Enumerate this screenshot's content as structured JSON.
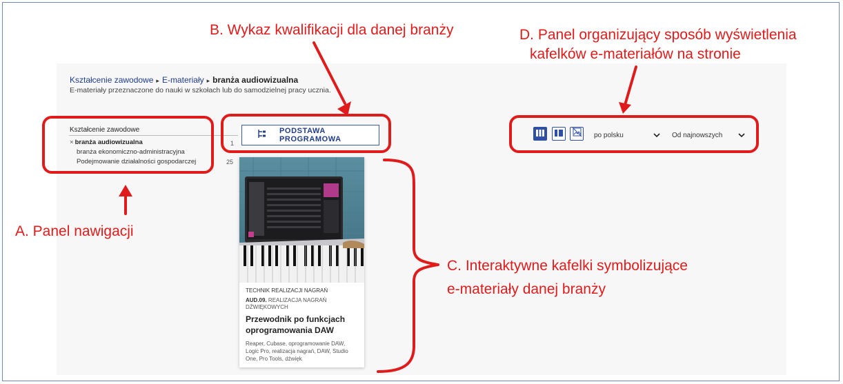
{
  "annotations": {
    "b_label": "B. Wykaz kwalifikacji dla danej branży",
    "d_label_line1": "D. Panel organizujący sposób wyświetlenia",
    "d_label_line2": "kafelków e-materiałów na stronie",
    "a_label": "A. Panel nawigacji",
    "c_label_line1": "C. Interaktywne kafelki symbolizujące",
    "c_label_line2": "e-materiały  danej branży",
    "color": "#e01b1b"
  },
  "breadcrumb": {
    "item1": "Kształcenie zawodowe",
    "item2": "E-materiały",
    "current": "branża audiowizualna",
    "separator": "▸"
  },
  "subtitle": "E-materiały przeznaczone do nauki w szkołach lub do samodzielnej pracy ucznia.",
  "nav": {
    "title": "Kształcenie zawodowe",
    "remove_glyph": "×",
    "selected": "branża audiowizualna",
    "selected_count": "1",
    "items": [
      {
        "label": "branża ekonomiczno-administracyjna"
      },
      {
        "label": "Podejmowanie działalności gospodarczej",
        "count": "25"
      }
    ]
  },
  "program_button": {
    "label": "PODSTAWA PROGRAMOWA"
  },
  "view_panel": {
    "view_buttons": [
      {
        "icon": "grid-three-columns-icon",
        "active": true
      },
      {
        "icon": "grid-two-columns-icon",
        "active": false
      },
      {
        "icon": "image-off-icon",
        "active": false
      }
    ],
    "language_select": "po polsku",
    "sort_select": "Od najnowszych"
  },
  "card": {
    "category": "TECHNIK REALIZACJI NAGRAŃ",
    "code": "AUD.09.",
    "code_desc": "REALIZACJA NAGRAŃ DŹWIĘKOWYCH",
    "title": "Przewodnik po funkcjach oprogramowania DAW",
    "tags": "Reaper, Cubase, oprogramowanie DAW, Logic Pro, realizacja nagrań, DAW, Studio One, Pro Tools, dźwięk"
  },
  "colors": {
    "accent": "#1f3c88",
    "active_view": "#2f4fa2"
  }
}
